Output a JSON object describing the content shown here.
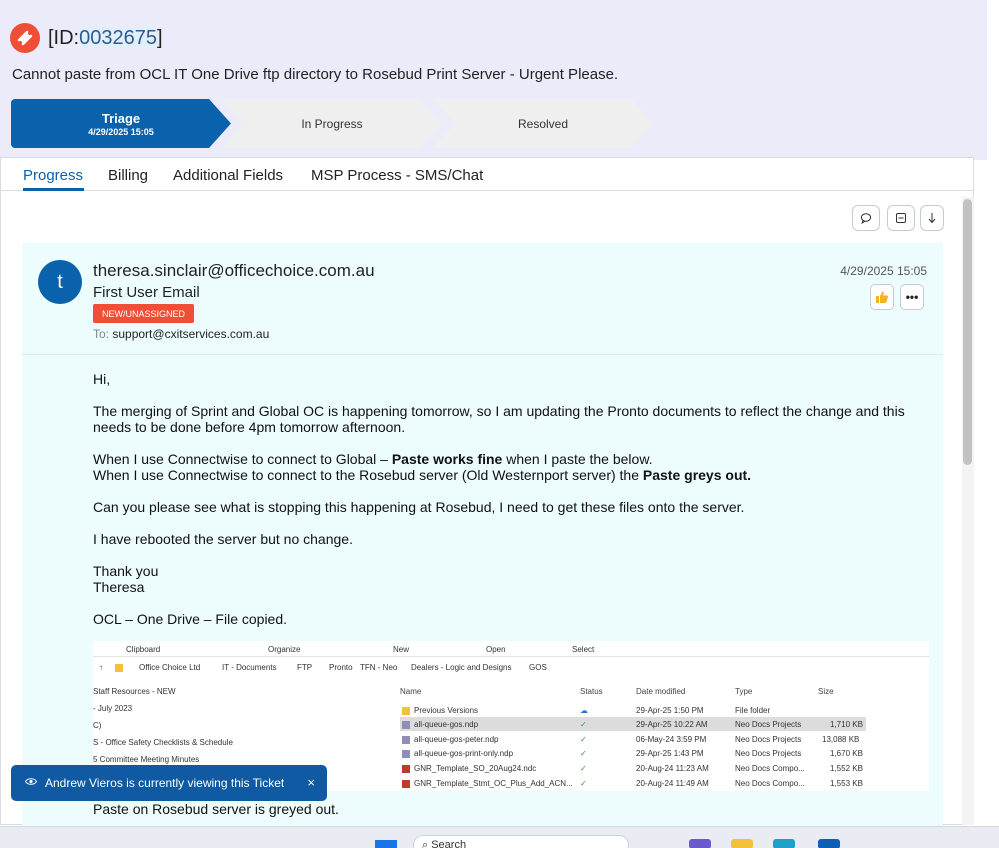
{
  "ticket": {
    "id_prefix": "[ID:",
    "id_number": "0032675",
    "id_suffix": "]",
    "title": "Cannot paste from OCL IT One Drive ftp directory to Rosebud Print Server - Urgent Please."
  },
  "stages": [
    {
      "name": "Triage",
      "date": "4/29/2025 15:05"
    },
    {
      "name": "In Progress"
    },
    {
      "name": "Resolved"
    }
  ],
  "tabs": [
    "Progress",
    "Billing",
    "Additional Fields",
    "MSP Process - SMS/Chat"
  ],
  "email": {
    "avatar_letter": "t",
    "from": "theresa.sinclair@officechoice.com.au",
    "subject": "First User Email",
    "badge": "NEW/UNASSIGNED",
    "to_label": "To:",
    "to": "support@cxitservices.com.au",
    "date": "4/29/2025 15:05",
    "body": {
      "greeting": "Hi,",
      "p1": "The merging of Sprint and Global OC is happening tomorrow, so I am updating the Pronto documents to reflect the change and this needs to be done before 4pm tomorrow afternoon.",
      "p2a_pre": "When I use Connectwise to connect to Global – ",
      "p2a_bold": "Paste works fine",
      "p2a_post": " when I paste the below.",
      "p2b_pre": "When I use Connectwise to connect to the Rosebud server (Old Westernport server) the ",
      "p2b_bold": "Paste greys out.",
      "p3": "Can you please see what is stopping this happening at Rosebud, I need to get these files onto the server.",
      "p4": "I have rebooted the server but no change.",
      "sign1": "Thank you",
      "sign2": "Theresa",
      "caption1": "OCL – One Drive – File copied.",
      "caption2": "Paste on Rosebud server is greyed out."
    }
  },
  "explorer": {
    "ribbon": [
      "Clipboard",
      "Organize",
      "New",
      "Open",
      "Select"
    ],
    "path": [
      "Office Choice Ltd",
      "IT - Documents",
      "FTP",
      "Pronto",
      "TFN - Neo",
      "Dealers - Logic and Designs",
      "GOS"
    ],
    "nav": [
      "Staff Resources - NEW",
      "- July 2023",
      "C)",
      "S - Office Safety Checklists & Schedule",
      "5 Committee Meeting Minutes"
    ],
    "columns": [
      "Name",
      "Status",
      "Date modified",
      "Type",
      "Size"
    ],
    "files": [
      {
        "name": "Previous Versions",
        "status": "☁",
        "date": "29-Apr-25 1:50 PM",
        "type": "File folder",
        "size": ""
      },
      {
        "name": "all-queue-gos.ndp",
        "status": "✓",
        "date": "29-Apr-25 10:22 AM",
        "type": "Neo Docs Projects",
        "size": "1,710 KB"
      },
      {
        "name": "all-queue-gos-peter.ndp",
        "status": "✓",
        "date": "06-May-24 3:59 PM",
        "type": "Neo Docs Projects",
        "size": "13,088 KB"
      },
      {
        "name": "all-queue-gos-print-only.ndp",
        "status": "✓",
        "date": "29-Apr-25 1:43 PM",
        "type": "Neo Docs Projects",
        "size": "1,670 KB"
      },
      {
        "name": "GNR_Template_SO_20Aug24.ndc",
        "status": "✓",
        "date": "20-Aug-24 11:23 AM",
        "type": "Neo Docs Compo...",
        "size": "1,552 KB"
      },
      {
        "name": "GNR_Template_Stmt_OC_Plus_Add_ACN...",
        "status": "✓",
        "date": "20-Aug-24 11:49 AM",
        "type": "Neo Docs Compo...",
        "size": "1,553 KB"
      }
    ]
  },
  "toast": {
    "text": "Andrew Vieros is currently viewing this Ticket",
    "close": "×"
  },
  "taskbar": {
    "search_placeholder": "Search"
  },
  "colors": {
    "accent": "#0a62ad",
    "badge": "#f04e37",
    "email_bg": "#edfdfe"
  }
}
